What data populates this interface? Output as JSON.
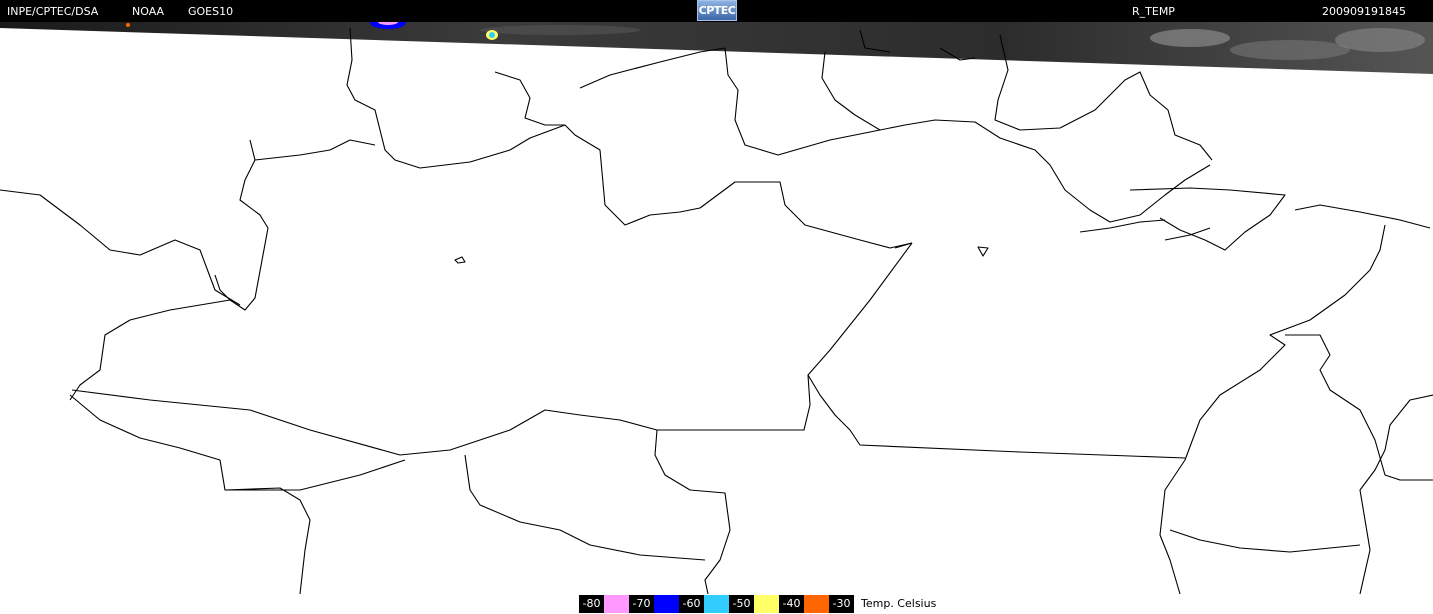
{
  "header": {
    "institution": "INPE/CPTEC/DSA",
    "agency": "NOAA",
    "satellite": "GOES10",
    "logo_text": "CPTEC",
    "product": "R_TEMP",
    "timestamp": "200909191845"
  },
  "legend": {
    "items": [
      {
        "label": "-80",
        "color": "#ff99ff"
      },
      {
        "label": "-70",
        "color": "#0000ff"
      },
      {
        "label": "-60",
        "color": "#33ccff"
      },
      {
        "label": "-50",
        "color": "#ffff66"
      },
      {
        "label": "-40",
        "color": "#ff6600"
      },
      {
        "label": "-30",
        "color": ""
      }
    ],
    "units": "Temp. Celsius"
  },
  "colors": {
    "background": "#ffffff",
    "borders": "#000000",
    "cloud_strip": "#3a3a3a"
  }
}
